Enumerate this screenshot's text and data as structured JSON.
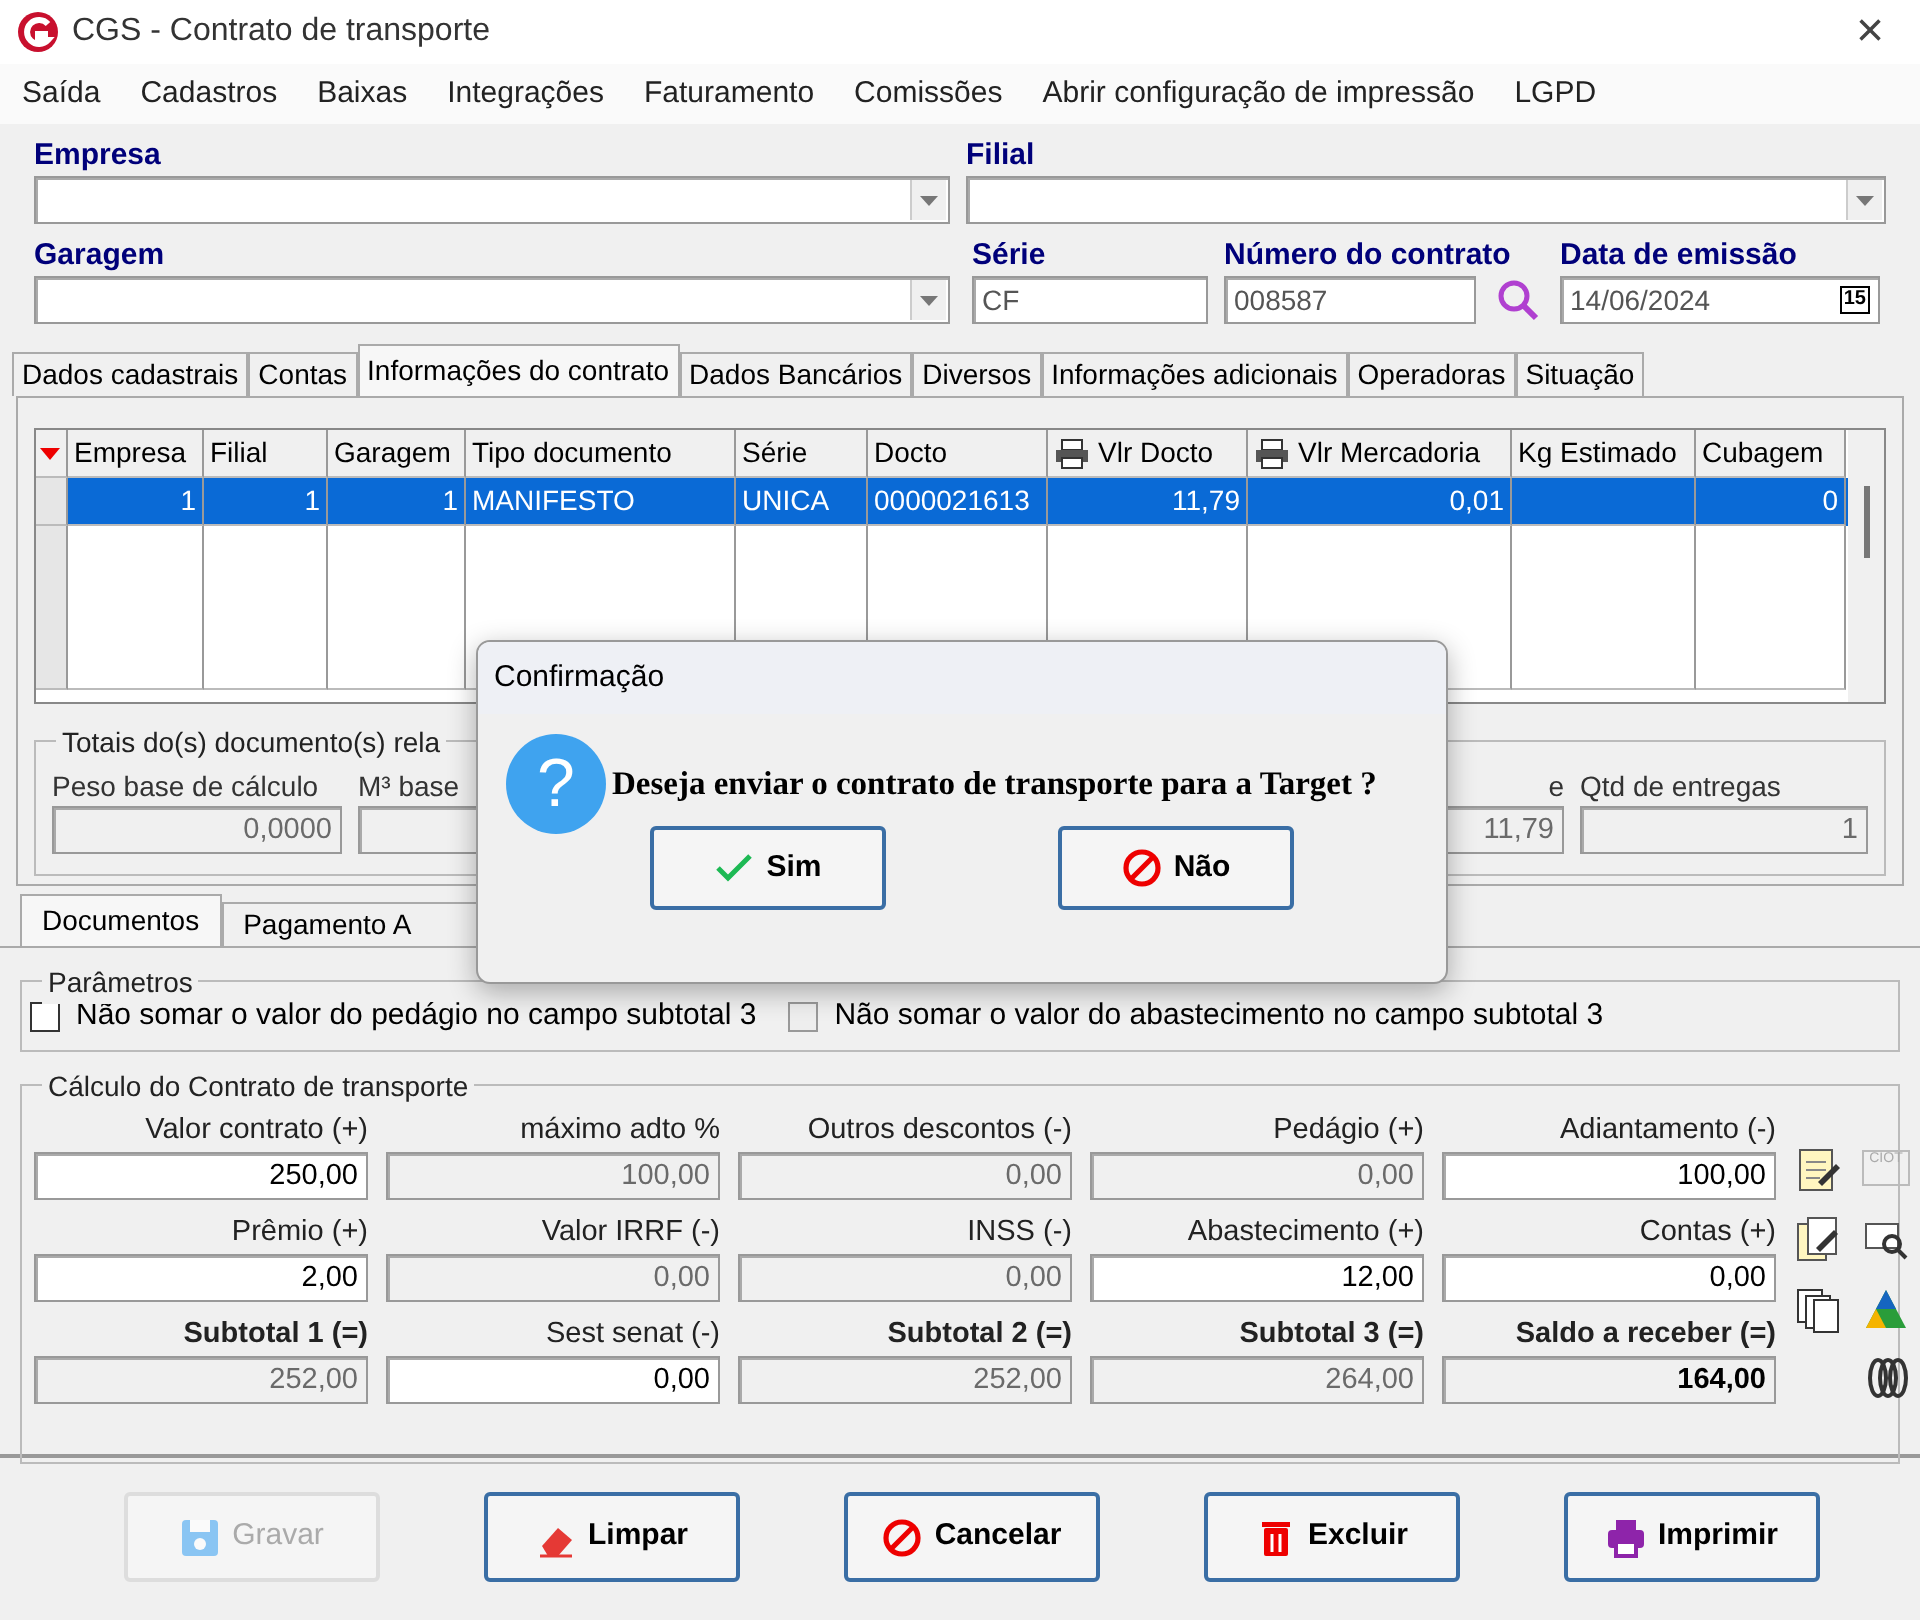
{
  "window": {
    "title": "CGS - Contrato de transporte",
    "close": "×"
  },
  "menu": [
    "Saída",
    "Cadastros",
    "Baixas",
    "Integrações",
    "Faturamento",
    "Comissões",
    "Abrir configuração de impressão",
    "LGPD"
  ],
  "header": {
    "empresa": {
      "label": "Empresa"
    },
    "filial": {
      "label": "Filial"
    },
    "garagem": {
      "label": "Garagem"
    },
    "serie": {
      "label": "Série",
      "value": "CF"
    },
    "numero": {
      "label": "Número do contrato",
      "value": "008587"
    },
    "data": {
      "label": "Data de emissão",
      "value": "14/06/2024",
      "calendar": "15"
    }
  },
  "tabs": [
    {
      "label": "Dados cadastrais",
      "selected": false
    },
    {
      "label": "Contas",
      "selected": false
    },
    {
      "label": "Informações do contrato",
      "selected": true
    },
    {
      "label": "Dados Bancários",
      "selected": false
    },
    {
      "label": "Diversos",
      "selected": false
    },
    {
      "label": "Informações adicionais",
      "selected": false
    },
    {
      "label": "Operadoras",
      "selected": false
    },
    {
      "label": "Situação",
      "selected": false
    }
  ],
  "table": {
    "columns": [
      {
        "label": "Empresa",
        "kind": "number"
      },
      {
        "label": "Filial",
        "kind": "number"
      },
      {
        "label": "Garagem",
        "kind": "number"
      },
      {
        "label": "Tipo documento",
        "kind": "text"
      },
      {
        "label": "Série",
        "kind": "text"
      },
      {
        "label": "Docto",
        "kind": "text"
      },
      {
        "label": "Vlr Docto",
        "kind": "print"
      },
      {
        "label": "Vlr Mercadoria",
        "kind": "print"
      },
      {
        "label": "Kg Estimado",
        "kind": "number"
      },
      {
        "label": "Cubagem",
        "kind": "number"
      }
    ],
    "rows": [
      {
        "selected": true,
        "cells": [
          "1",
          "1",
          "1",
          "MANIFESTO",
          "UNICA",
          "0000021613",
          "11,79",
          "0,01",
          null,
          "0"
        ]
      }
    ]
  },
  "totals": {
    "title": "Totais do(s) documento(s) rela",
    "fields": [
      {
        "label": "Peso base de cálculo",
        "value": "0,0000"
      },
      {
        "label": "M³ base"
      },
      {
        "label": "e",
        "value": "11,79"
      },
      {
        "label": "Qtd de entregas",
        "value": "1"
      }
    ]
  },
  "subtabs": [
    {
      "label": "Documentos",
      "selected": true
    },
    {
      "label": "Pagamento A",
      "selected": false
    }
  ],
  "parametros": {
    "title": "Parâmetros",
    "checkboxes": [
      {
        "label": "Não somar o valor do pedágio no campo subtotal 3",
        "checked": false,
        "disabled": false
      },
      {
        "label": "Não somar o valor do abastecimento no campo subtotal 3",
        "checked": false,
        "disabled": true
      }
    ]
  },
  "calculo": {
    "title": "Cálculo do Contrato de transporte",
    "ciot": "CIOT",
    "fields": [
      {
        "label": "Valor contrato (+)",
        "value": "250,00",
        "kind": "input"
      },
      {
        "label": "máximo adto %",
        "value": "100,00",
        "kind": "readonly"
      },
      {
        "label": "Outros descontos (-)",
        "value": "0,00",
        "kind": "readonly"
      },
      {
        "label": "Pedágio (+)",
        "value": "0,00",
        "kind": "readonly"
      },
      {
        "label": "Adiantamento (-)",
        "value": "100,00",
        "kind": "input"
      },
      {
        "label": "Prêmio (+)",
        "value": "2,00",
        "kind": "input"
      },
      {
        "label": "Valor IRRF (-)",
        "value": "0,00",
        "kind": "readonly"
      },
      {
        "label": "INSS (-)",
        "value": "0,00",
        "kind": "readonly"
      },
      {
        "label": "Abastecimento (+)",
        "value": "12,00",
        "kind": "input"
      },
      {
        "label": "Contas (+)",
        "value": "0,00",
        "kind": "input"
      },
      {
        "label": "Subtotal 1 (=)",
        "value": "252,00",
        "kind": "subtotal"
      },
      {
        "label": "Sest senat (-)",
        "value": "0,00",
        "kind": "input"
      },
      {
        "label": "Subtotal 2 (=)",
        "value": "252,00",
        "kind": "subtotal"
      },
      {
        "label": "Subtotal 3 (=)",
        "value": "264,00",
        "kind": "subtotal"
      },
      {
        "label": "Saldo a receber (=)",
        "value": "164,00",
        "kind": "result"
      }
    ]
  },
  "buttons": [
    {
      "label": "Gravar",
      "kind": "save",
      "disabled": true
    },
    {
      "label": "Limpar",
      "kind": "clear",
      "disabled": false
    },
    {
      "label": "Cancelar",
      "kind": "cancel",
      "disabled": false
    },
    {
      "label": "Excluir",
      "kind": "delete",
      "disabled": false
    },
    {
      "label": "Imprimir",
      "kind": "print",
      "disabled": false
    }
  ],
  "dialog": {
    "title": "Confirmação",
    "icon": "?",
    "message": "Deseja enviar o contrato de transporte para a Target ?",
    "buttons": [
      {
        "label": "Sim",
        "kind": "yes"
      },
      {
        "label": "Não",
        "kind": "no"
      }
    ]
  }
}
